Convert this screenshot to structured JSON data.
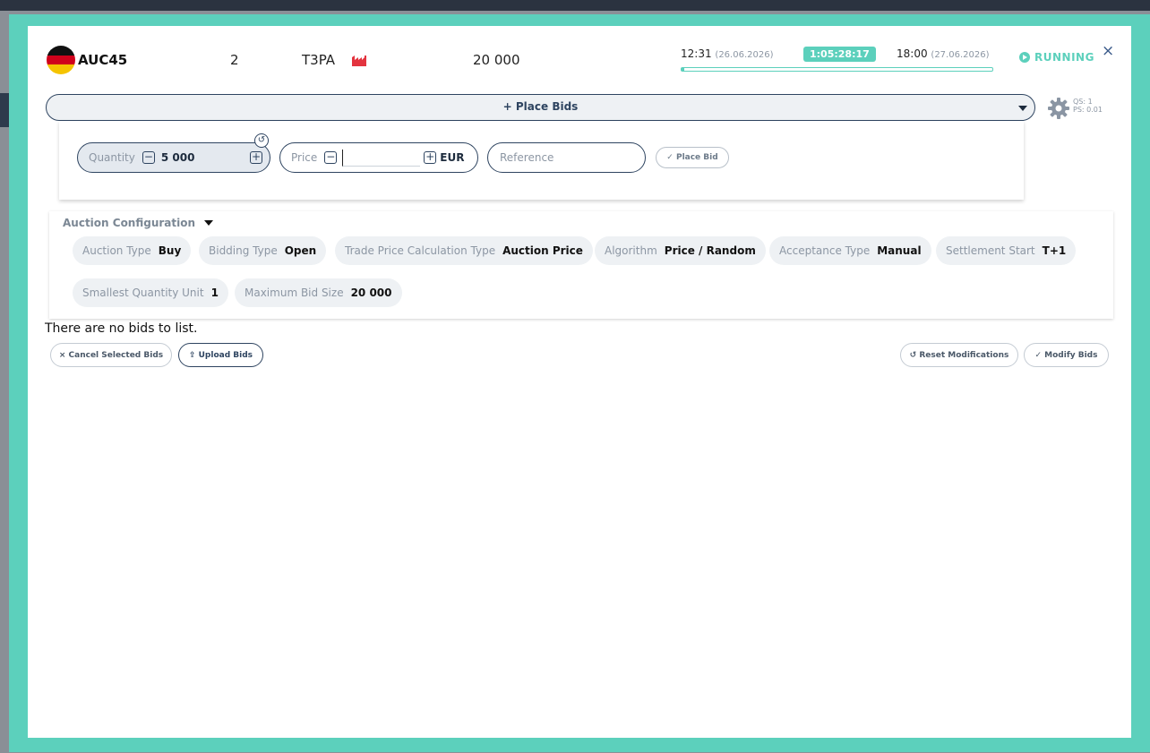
{
  "header": {
    "auction_name": "AUC45",
    "lot_number": "2",
    "product_code": "T3PA",
    "quantity": "20 000",
    "start_time": "12:31",
    "start_date": "(26.06.2026)",
    "countdown": "1:05:28:17",
    "end_time": "18:00",
    "end_date": "(27.06.2026)",
    "status": "RUNNING",
    "close_symbol": "×",
    "flag_icon": "germany-flag-icon",
    "product_icon": "factory-icon",
    "accent_color": "#5cd0bc"
  },
  "place_bids": {
    "bar_label": "+ Place Bids",
    "qs": "QS: 1",
    "ps": "PS: 0.01",
    "quantity_label": "Quantity",
    "quantity_value": "5 000",
    "minus": "−",
    "plus": "+",
    "reset_symbol": "↺",
    "price_label": "Price",
    "price_value": "",
    "currency": "EUR",
    "reference_placeholder": "Reference",
    "place_bid_label": "✓ Place Bid"
  },
  "config": {
    "title": "Auction Configuration",
    "items": [
      {
        "key": "Auction Type",
        "value": "Buy"
      },
      {
        "key": "Bidding Type",
        "value": "Open"
      },
      {
        "key": "Trade Price Calculation Type",
        "value": "Auction Price"
      },
      {
        "key": "Algorithm",
        "value": "Price / Random"
      },
      {
        "key": "Acceptance Type",
        "value": "Manual"
      },
      {
        "key": "Settlement Start",
        "value": "T+1"
      },
      {
        "key": "Smallest Quantity Unit",
        "value": "1"
      },
      {
        "key": "Maximum Bid Size",
        "value": "20 000"
      }
    ]
  },
  "bids": {
    "empty_message": "There are no bids to list.",
    "cancel_selected_label": "× Cancel Selected Bids",
    "upload_label": "⇪ Upload Bids",
    "reset_modifications_label": "↺ Reset Modifications",
    "modify_label": "✓ Modify Bids"
  }
}
